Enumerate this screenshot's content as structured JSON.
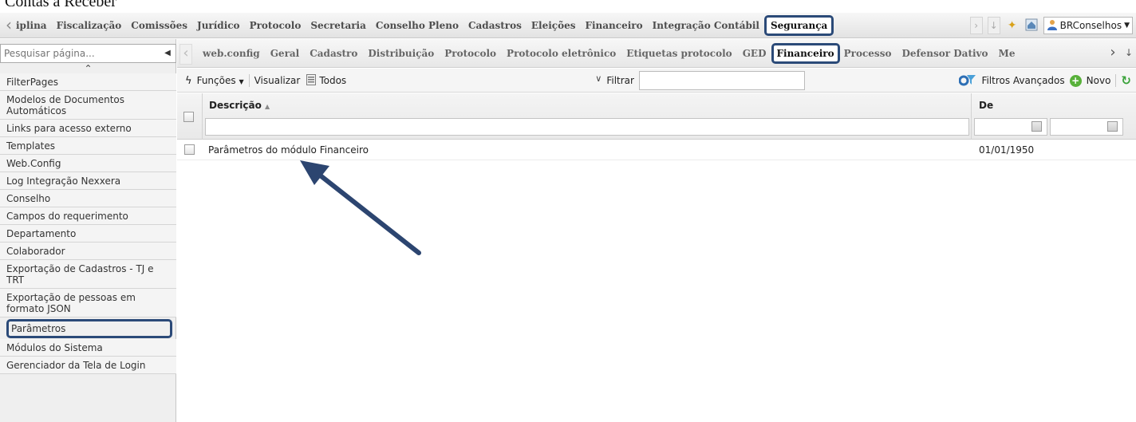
{
  "doc_title": "Contas a Receber",
  "top_menu": {
    "items": [
      "iplina",
      "Fiscalização",
      "Comissões",
      "Jurídico",
      "Protocolo",
      "Secretaria",
      "Conselho Pleno",
      "Cadastros",
      "Eleições",
      "Financeiro",
      "Integração Contábil"
    ],
    "active": "Segurança",
    "user": "BRConselhos"
  },
  "sidebar": {
    "search_placeholder": "Pesquisar página...",
    "items": [
      "FilterPages",
      "Modelos de Documentos Automáticos",
      "Links para acesso externo",
      "Templates",
      "Web.Config",
      "Log Integração Nexxera",
      "Conselho",
      "Campos do requerimento",
      "Departamento",
      "Colaborador",
      "Exportação de Cadastros - TJ e TRT",
      "Exportação de pessoas em formato JSON",
      "Parâmetros",
      "Módulos do Sistema",
      "Gerenciador da Tela de Login"
    ],
    "highlighted": "Parâmetros"
  },
  "tabs": {
    "items": [
      "web.config",
      "Geral",
      "Cadastro",
      "Distribuição",
      "Protocolo",
      "Protocolo eletrônico",
      "Etiquetas protocolo",
      "GED"
    ],
    "active": "Financeiro",
    "after": [
      "Processo",
      "Defensor Dativo",
      "Me"
    ]
  },
  "toolbar": {
    "functions": "Funções",
    "view_label": "Visualizar",
    "view_value": "Todos",
    "filter_label": "Filtrar",
    "advanced_filters": "Filtros Avançados",
    "new": "Novo"
  },
  "grid": {
    "col_desc": "Descrição",
    "col_de": "De",
    "rows": [
      {
        "descricao": "Parâmetros do módulo Financeiro",
        "de": "01/01/1950"
      }
    ]
  },
  "colors": {
    "highlight_border": "#2b4a78",
    "arrow": "#2c4570"
  }
}
